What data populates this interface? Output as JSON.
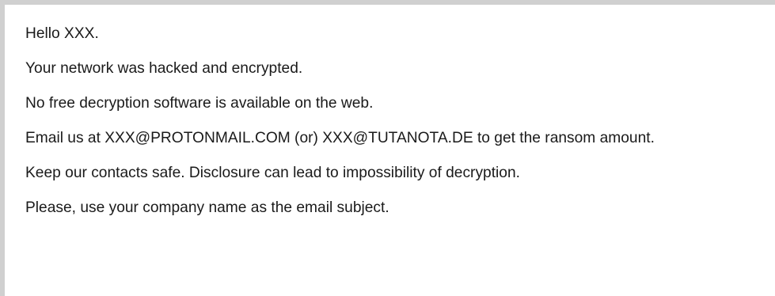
{
  "note": {
    "lines": [
      "Hello XXX.",
      "Your network was hacked and encrypted.",
      "No free decryption software is available on the web.",
      "Email us at XXX@PROTONMAIL.COM (or) XXX@TUTANOTA.DE to get the ransom amount.",
      "Keep our contacts safe. Disclosure can lead to impossibility of decryption.",
      "Please, use your company name as the email subject."
    ]
  }
}
